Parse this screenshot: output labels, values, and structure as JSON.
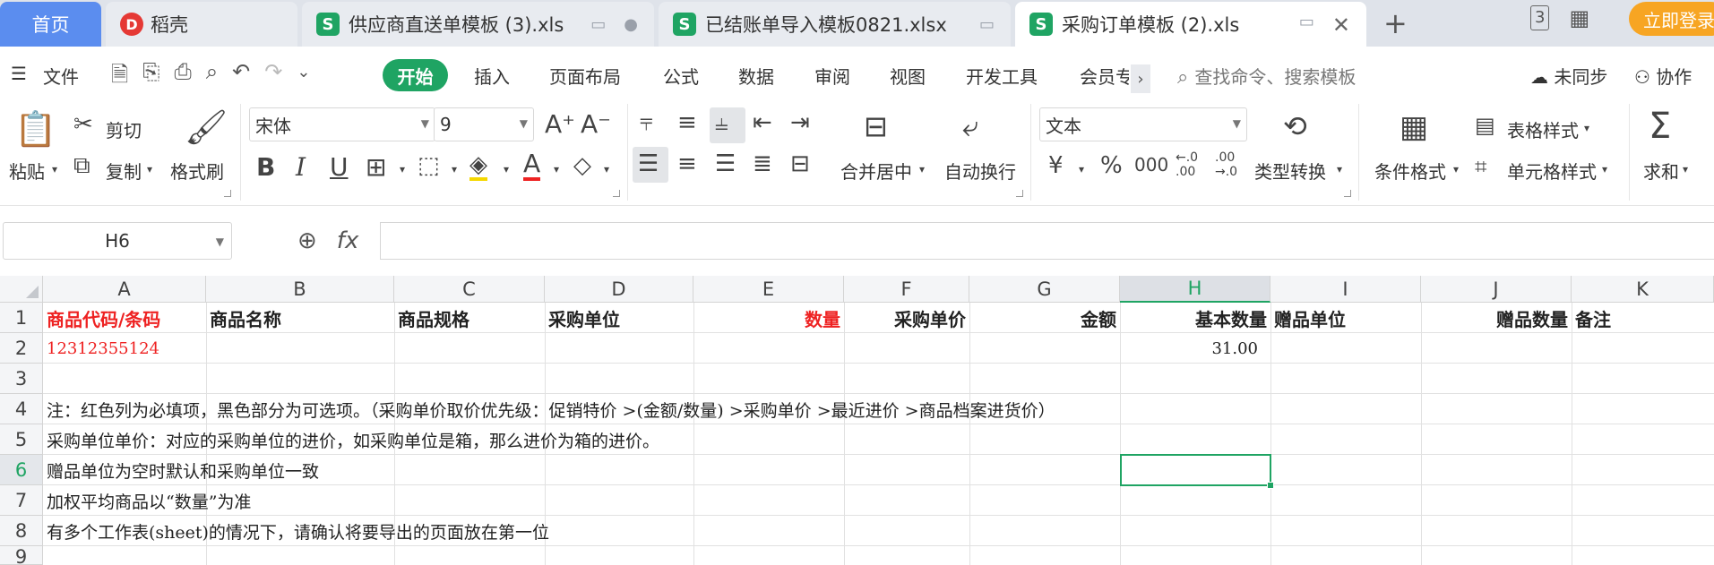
{
  "tabs": {
    "home": "首页",
    "daoke": "稻壳",
    "file1": "供应商直送单模板 (3).xls",
    "file2": "已结账单导入模板0821.xlsx",
    "file3": "采购订单模板 (2).xls",
    "file_icon": "S",
    "add": "+",
    "login": "立即登录",
    "page_count": "3"
  },
  "menu": {
    "file": "文件",
    "start": "开始",
    "items": [
      "插入",
      "页面布局",
      "公式",
      "数据",
      "审阅",
      "视图",
      "开发工具",
      "会员专"
    ],
    "more": "›",
    "search": "查找命令、搜索模板",
    "sync": "未同步",
    "collab": "协作"
  },
  "ribbon": {
    "paste": "粘贴",
    "cut": "剪切",
    "copy": "复制",
    "format_painter": "格式刷",
    "font_name": "宋体",
    "font_size": "9",
    "merge_center": "合并居中",
    "wrap_text": "自动换行",
    "number_format": "文本",
    "type_convert": "类型转换",
    "cond_format": "条件格式",
    "table_style": "表格样式",
    "cell_style": "单元格样式",
    "sum": "求和",
    "percent": "%",
    "thousands": "000",
    "currency": "¥"
  },
  "formula_bar": {
    "cell_ref": "H6",
    "fx": "fx",
    "value": ""
  },
  "grid": {
    "columns": [
      "A",
      "B",
      "C",
      "D",
      "E",
      "F",
      "G",
      "H",
      "I",
      "J",
      "K"
    ],
    "selected_column": "H",
    "rows": [
      "1",
      "2",
      "3",
      "4",
      "5",
      "6",
      "7",
      "8",
      "9"
    ],
    "selected_row": "6",
    "header_row": {
      "A": "商品代码/条码",
      "B": "商品名称",
      "C": "商品规格",
      "D": "采购单位",
      "E": "数量",
      "F": "采购单价",
      "G": "金额",
      "H": "基本数量",
      "I": "赠品单位",
      "J": "赠品数量",
      "K": "备注"
    },
    "row2": {
      "A": "12312355124",
      "H": "31.00"
    },
    "notes": [
      "注：红色列为必填项，黑色部分为可选项。（采购单价取价优先级：促销特价 >(金额/数量) >采购单价 >最近进价 >商品档案进货价）",
      "采购单位单价：对应的采购单位的进价，如采购单位是箱，那么进价为箱的进价。",
      "赠品单位为空时默认和采购单位一致",
      "加权平均商品以“数量”为准",
      "有多个工作表(sheet)的情况下，请确认将要导出的页面放在第一位"
    ]
  },
  "colors": {
    "accent": "#1fa463",
    "required": "#e22222",
    "home_tab": "#5b8def",
    "login": "#f7a523"
  }
}
